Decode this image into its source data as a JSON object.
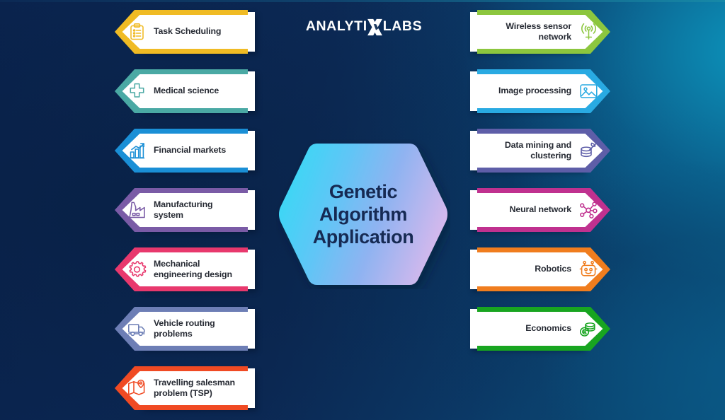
{
  "background": {
    "base_color": "#0b2a52",
    "accent_glow": "#0d96be"
  },
  "logo": {
    "part1": "ANALYTI",
    "mark": "X",
    "part2": "LABS",
    "color": "#ffffff"
  },
  "center": {
    "title_line1": "Genetic",
    "title_line2": "Algorithm",
    "title_line3": "Application",
    "text_color": "#162a53",
    "gradient_from": "#3ad8f5",
    "gradient_mid": "#7fa9f0",
    "gradient_to": "#dcb9ec"
  },
  "left_items": [
    {
      "label": "Task Scheduling",
      "icon": "clipboard-list-icon",
      "color": "#f0bb24"
    },
    {
      "label": "Medical science",
      "icon": "medical-cross-icon",
      "color": "#4aa9a4"
    },
    {
      "label": "Financial markets",
      "icon": "bar-chart-up-icon",
      "color": "#1a8fd6"
    },
    {
      "label": "Manufacturing system",
      "icon": "factory-icon",
      "color": "#7a5ba6"
    },
    {
      "label": "Mechanical engineering design",
      "icon": "gear-icon",
      "color": "#e8386d"
    },
    {
      "label": "Vehicle routing problems",
      "icon": "truck-icon",
      "color": "#6d7eb5"
    },
    {
      "label": "Travelling salesman problem (TSP)",
      "icon": "map-pin-icon",
      "color": "#f04a23"
    }
  ],
  "right_items": [
    {
      "label": "Wireless sensor network",
      "icon": "wireless-signal-icon",
      "color": "#8cc63e"
    },
    {
      "label": "Image processing",
      "icon": "image-photo-icon",
      "color": "#29aae2"
    },
    {
      "label": "Data mining and clustering",
      "icon": "database-pickaxe-icon",
      "color": "#5e5ea8"
    },
    {
      "label": "Neural network",
      "icon": "neural-nodes-icon",
      "color": "#c0318f"
    },
    {
      "label": "Robotics",
      "icon": "robot-face-icon",
      "color": "#f07d1e"
    },
    {
      "label": "Economics",
      "icon": "coins-stack-icon",
      "color": "#18a520"
    }
  ]
}
